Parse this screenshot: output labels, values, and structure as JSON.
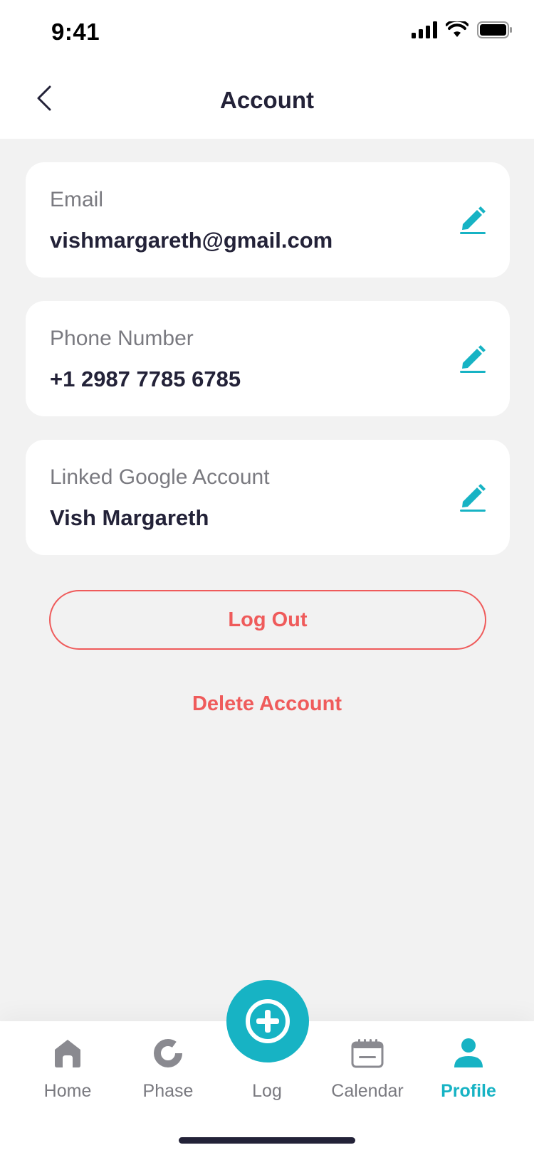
{
  "status_bar": {
    "time": "9:41"
  },
  "header": {
    "title": "Account"
  },
  "fields": [
    {
      "label": "Email",
      "value": "vishmargareth@gmail.com"
    },
    {
      "label": "Phone Number",
      "value": "+1 2987 7785 6785"
    },
    {
      "label": "Linked Google Account",
      "value": "Vish Margareth"
    }
  ],
  "actions": {
    "logout": "Log Out",
    "delete": "Delete Account"
  },
  "tab_bar": {
    "tabs": [
      {
        "label": "Home",
        "icon": "home-icon"
      },
      {
        "label": "Phase",
        "icon": "phase-icon"
      },
      {
        "label": "Log",
        "icon": "add-circle-icon"
      },
      {
        "label": "Calendar",
        "icon": "calendar-icon"
      },
      {
        "label": "Profile",
        "icon": "user-icon",
        "active": true
      }
    ]
  },
  "colors": {
    "accent": "#17b3c4",
    "danger": "#ef5b5b",
    "text": "#232238",
    "muted": "#7a7a80",
    "background": "#f2f2f2"
  }
}
